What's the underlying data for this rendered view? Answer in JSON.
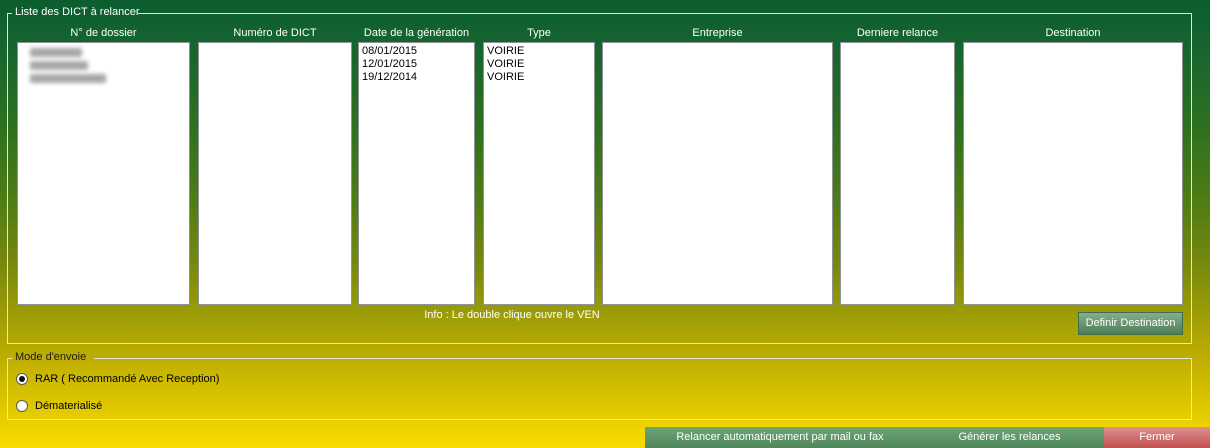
{
  "colors": {
    "groupbox_border": "#e3e3e3",
    "listbox_border": "#8f9297",
    "header_text": "#ffffff",
    "item_text": "#000000",
    "btn_green_top": "#85ae8c",
    "btn_green_bottom": "#4d7d55",
    "footer_green_top": "#6ea678",
    "footer_green_bottom": "#4f855a",
    "fermer_red_top": "#de9090",
    "fermer_red_bottom": "#c14f4f",
    "background_top": "#0b5d2e",
    "background_bottom": "#f8db00"
  },
  "liste_group": {
    "label": "Liste des DICT à relancer",
    "columns": [
      {
        "header": "N° de dossier",
        "items": [],
        "redacted_row_widths": [
          52,
          58,
          76
        ]
      },
      {
        "header": "Numéro de DICT",
        "items": []
      },
      {
        "header": "Date de la génération",
        "items": [
          "08/01/2015",
          "12/01/2015",
          "19/12/2014"
        ]
      },
      {
        "header": "Type",
        "items": [
          "VOIRIE",
          "VOIRIE",
          "VOIRIE"
        ]
      },
      {
        "header": "Entreprise",
        "items": []
      },
      {
        "header": "Derniere relance",
        "items": []
      },
      {
        "header": "Destination",
        "items": []
      }
    ],
    "info_label": "Info : Le double clique ouvre le VEN",
    "definir_destination_button": "Definir Destination"
  },
  "mode_envoie_group": {
    "label": "Mode d'envoie",
    "options": [
      {
        "label": "RAR ( Recommandé Avec Reception)",
        "selected": true
      },
      {
        "label": "Dématerialisé",
        "selected": false
      }
    ]
  },
  "footer": {
    "relancer_button": "Relancer automatiquement par mail ou fax",
    "generer_button": "Générer les relances",
    "fermer_button": "Fermer"
  }
}
